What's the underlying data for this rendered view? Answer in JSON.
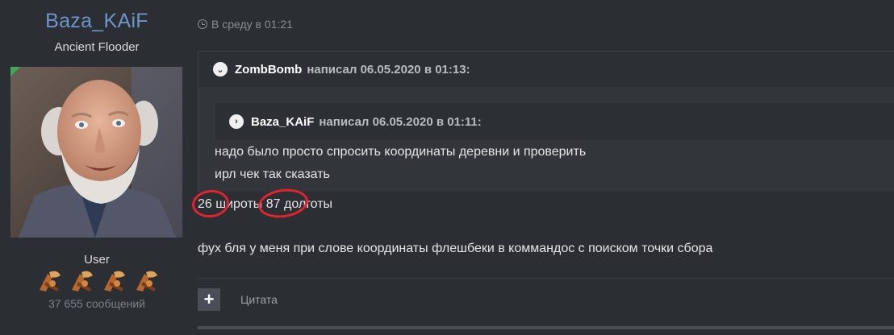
{
  "author": {
    "username": "Baza_KAiF",
    "title": "Ancient Flooder",
    "group": "User",
    "post_count": "37 655 сообщений"
  },
  "post": {
    "date": "В среду в 01:21",
    "quote_outer": {
      "author": "ZombBomb",
      "meta": "написал 06.05.2020 в 01:13:"
    },
    "quote_inner": {
      "author": "Baza_KAiF",
      "meta": "написал 06.05.2020 в 01:11:"
    },
    "quote_text_lines": [
      "надо было просто спросить координаты деревни и проверить",
      "ирл чек так сказать"
    ],
    "body_lines": [
      "26 широты 87 долготы",
      "фух бля у меня при слове координаты флешбеки в коммандос с поиском точки сбора"
    ],
    "actions": {
      "plus_label": "+",
      "quote_label": "Цитата"
    }
  },
  "colors": {
    "background": "#2b2e33",
    "username": "#6d95c9",
    "annotation": "#e0232d"
  }
}
